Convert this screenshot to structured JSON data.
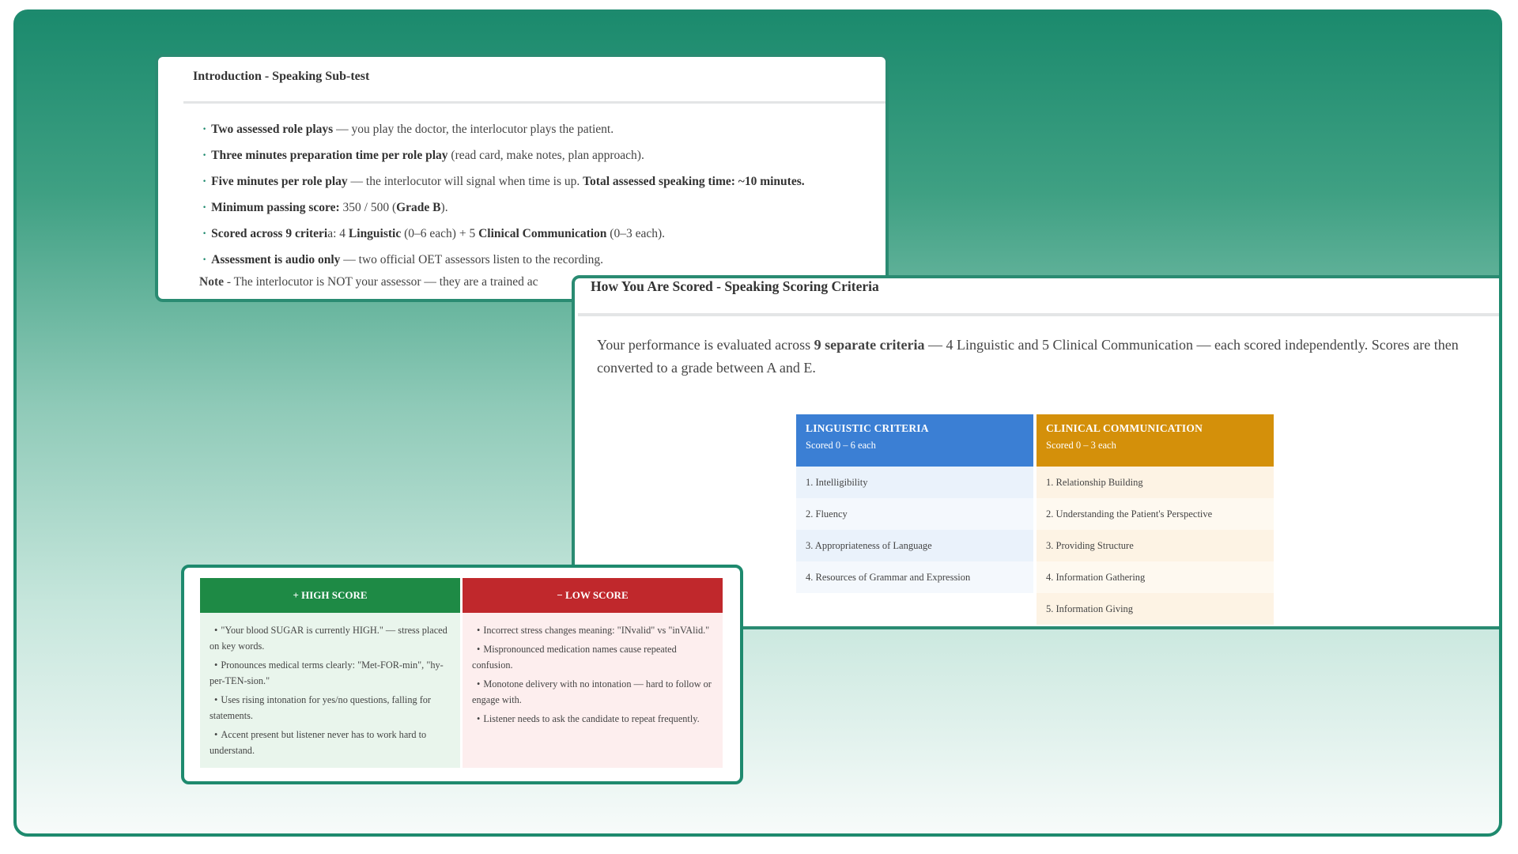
{
  "intro_card": {
    "title": "Introduction - Speaking Sub-test",
    "bullets": [
      {
        "bold1": "Two assessed role plays",
        "text1": " — you play the doctor, the interlocutor plays the patient."
      },
      {
        "bold1": "Three minutes preparation time per role play",
        "text1": " (read card, make notes, plan approach)."
      },
      {
        "bold1": "Five minutes per role play",
        "text1": " — the interlocutor will signal when time is up. ",
        "bold2": "Total assessed speaking time: ~10 minutes."
      },
      {
        "bold1": "Minimum passing score:",
        "text1": " 350 / 500 (",
        "bold2": "Grade B",
        "text2": ")."
      },
      {
        "bold1": "Scored across 9 criteri",
        "text1": "a: 4 ",
        "bold2": "Linguistic",
        "text2": " (0–6 each) + 5 ",
        "bold3": "Clinical Communication",
        "text3": " (0–3 each)."
      },
      {
        "bold1": "Assessment is audio only",
        "text1": " — two official OET assessors listen to the recording."
      }
    ],
    "note_label": "Note",
    "note_text": " - The interlocutor is NOT your assessor — they are a trained ac"
  },
  "scored_card": {
    "title": "How You Are Scored - Speaking Scoring Criteria",
    "intro_a": "Your performance is evaluated across ",
    "intro_b": "9 separate criteria",
    "intro_c": " — 4 Linguistic and 5 Clinical Communication — each scored independently. Scores are then converted to a grade between A and E.",
    "linguistic": {
      "heading": "LINGUISTIC CRITERIA",
      "subheading": "Scored 0 – 6 each",
      "color": "#3b7fd4",
      "items": [
        "1.  Intelligibility",
        "2.  Fluency",
        "3.  Appropriateness of Language",
        "4.  Resources of Grammar and Expression"
      ]
    },
    "clinical": {
      "heading": "CLINICAL COMMUNICATION",
      "subheading": "Scored 0 – 3 each",
      "color": "#d4900a",
      "items": [
        "1.  Relationship Building",
        "2.  Understanding the Patient's Perspective",
        "3.  Providing Structure",
        "4.  Information Gathering",
        "5.  Information Giving"
      ]
    }
  },
  "compare_card": {
    "high": {
      "heading": "+ HIGH SCORE",
      "color": "#1e8a45",
      "items": [
        "\"Your blood SUGAR is currently HIGH.\" — stress placed on key words.",
        "Pronounces medical terms clearly: \"Met-FOR-min\", \"hy-per-TEN-sion.\"",
        "Uses rising intonation for yes/no questions, falling for statements.",
        "Accent present but listener never has to work hard to understand."
      ]
    },
    "low": {
      "heading": "− LOW SCORE",
      "color": "#c0282c",
      "items": [
        "Incorrect stress changes meaning: \"INvalid\" vs \"inVAlid.\"",
        "Mispronounced medication names cause repeated confusion.",
        "Monotone delivery with no intonation — hard to follow or engage with.",
        "Listener needs to ask the candidate to repeat frequently."
      ]
    }
  }
}
